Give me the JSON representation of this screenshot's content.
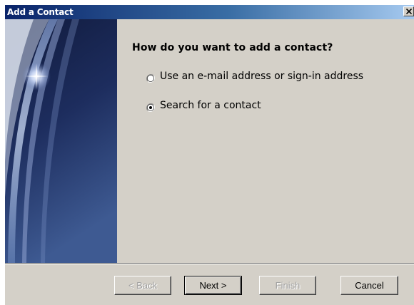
{
  "window": {
    "title": "Add a Contact",
    "close_icon": "close-icon"
  },
  "content": {
    "heading": "How do you want to add a contact?",
    "options": [
      {
        "label": "Use an e-mail address or sign-in address",
        "selected": false
      },
      {
        "label": "Search for a contact",
        "selected": true
      }
    ]
  },
  "buttons": {
    "back": "< Back",
    "next": "Next >",
    "finish": "Finish",
    "cancel": "Cancel"
  },
  "colors": {
    "dialog_background": "#d4d0c8",
    "titlebar_start": "#0a246a",
    "titlebar_end": "#a6caf0",
    "panel_dark": "#0f1a3e"
  }
}
